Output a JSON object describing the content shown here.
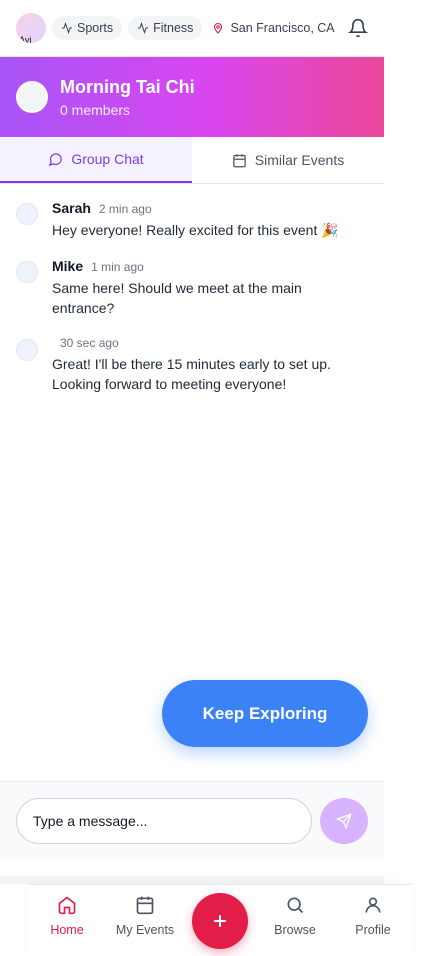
{
  "topbar": {
    "avatar_text": "Avi",
    "chips": [
      "Sports",
      "Fitness"
    ],
    "location": "San Francisco, CA"
  },
  "group": {
    "title": "Morning Tai Chi",
    "members": "0 members"
  },
  "tabs": [
    {
      "label": "Group Chat",
      "active": true
    },
    {
      "label": "Similar Events",
      "active": false
    }
  ],
  "messages": [
    {
      "name": "Sarah",
      "time": "2 min ago",
      "text": "Hey everyone! Really excited for this event 🎉"
    },
    {
      "name": "Mike",
      "time": "1 min ago",
      "text": "Same here! Should we meet at the main entrance?"
    },
    {
      "name": "",
      "time": "30 sec ago",
      "text": "Great! I'll be there 15 minutes early to set up. Looking forward to meeting everyone!"
    }
  ],
  "keep_exploring": "Keep Exploring",
  "composer": {
    "placeholder": "Type a message..."
  },
  "nav": {
    "home": "Home",
    "my_events": "My Events",
    "browse": "Browse",
    "profile": "Profile"
  },
  "colors": {
    "accent_purple": "#7c3aed",
    "accent_pink": "#e11d48",
    "button_blue": "#3b82f6",
    "header_gradient_start": "#a855f7",
    "header_gradient_end": "#ec4899"
  }
}
